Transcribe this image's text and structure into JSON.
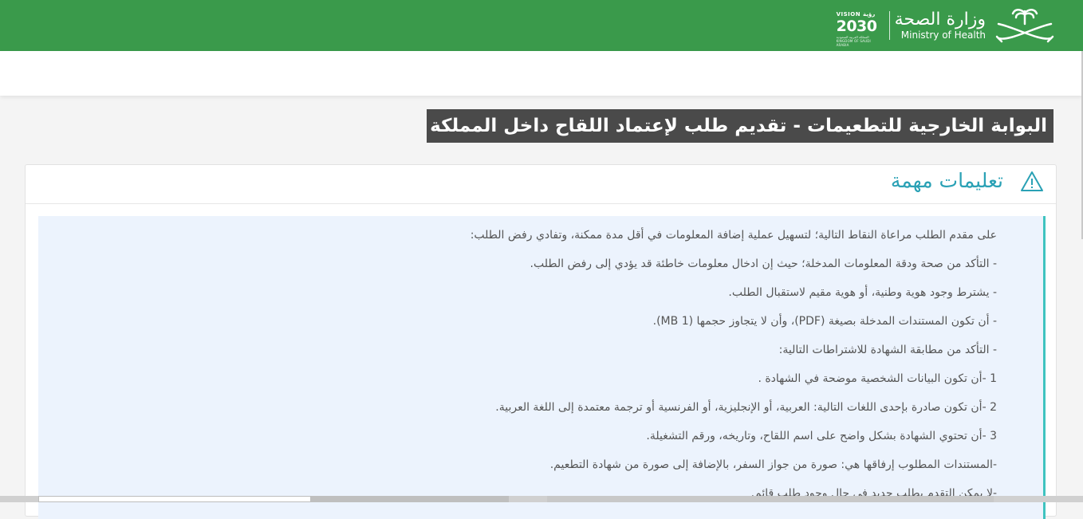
{
  "header": {
    "ministry_ar": "وزارة الصحة",
    "ministry_en": "Ministry of Health",
    "vision_top": "VISION رؤية",
    "vision_year": "2030",
    "vision_sub": "المملكة العربية السعودية KINGDOM OF SAUDI ARABIA",
    "brand_color": "#3a9a4b",
    "emblem_icon": "palm-swords-emblem-icon"
  },
  "page": {
    "title": "البوابة الخارجية للتطعيمات - تقديم طلب لإعتماد اللقاح داخل المملكة"
  },
  "instructions": {
    "title": "تعليمات مهمة",
    "icon": "warning-icon",
    "accent_color": "#2aa1b5",
    "lines": [
      "على مقدم الطلب مراعاة النقاط التالية؛ لتسهيل عملية إضافة المعلومات في أقل مدة ممكنة، وتفادي رفض الطلب:",
      "- التأكد من صحة ودقة المعلومات المدخلة؛ حيث إن ادخال معلومات خاطئة قد يؤدي إلى رفض الطلب.",
      "- يشترط وجود هوية وطنية، أو هوية مقيم لاستقبال الطلب.",
      "- أن تكون المستندات المدخلة بصيغة (PDF)، وأن لا يتجاوز حجمها (1 MB).",
      "- التأكد من مطابقة الشهادة للاشتراطات التالية:",
      "1 -أن تكون البيانات الشخصية موضحة في الشهادة .",
      "2 -أن تكون صادرة بإحدى اللغات التالية: العربية، أو الإنجليزية، أو الفرنسية أو ترجمة معتمدة إلى اللغة العربية.",
      "3 -أن تحتوي الشهادة بشكل واضح على اسم اللقاح، وتاريخه، ورقم التشغيلة.",
      "-المستندات المطلوب إرفاقها هي: صورة من جواز السفر، بالإضافة إلى صورة من شهادة التطعيم.",
      "-لا يمكن التقدم بطلب جديد في حال وجود طلب قائم."
    ]
  }
}
